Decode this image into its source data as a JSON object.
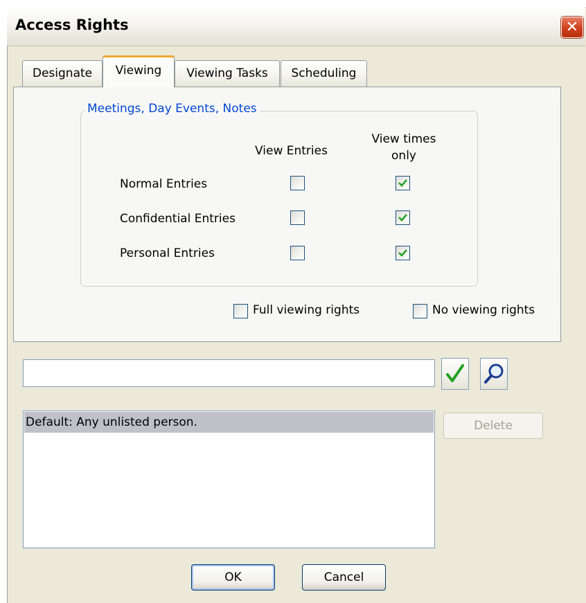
{
  "window": {
    "title": "Access Rights",
    "close_glyph": "✕"
  },
  "tabs": [
    {
      "label": "Designate",
      "active": false
    },
    {
      "label": "Viewing",
      "active": true
    },
    {
      "label": "Viewing Tasks",
      "active": false
    },
    {
      "label": "Scheduling",
      "active": false
    }
  ],
  "group": {
    "title": "Meetings, Day Events, Notes",
    "col_view_entries": "View Entries",
    "col_view_times_line1": "View times",
    "col_view_times_line2": "only",
    "rows": [
      {
        "label": "Normal Entries",
        "view_entries": false,
        "view_times_only": true
      },
      {
        "label": "Confidential Entries",
        "view_entries": false,
        "view_times_only": true
      },
      {
        "label": "Personal Entries",
        "view_entries": false,
        "view_times_only": true
      }
    ]
  },
  "options": {
    "full_viewing_rights": {
      "label": "Full viewing rights",
      "checked": false
    },
    "no_viewing_rights": {
      "label": "No viewing rights",
      "checked": false
    }
  },
  "name_input": {
    "value": ""
  },
  "icons": {
    "confirm": "check-icon",
    "search": "magnifier-icon"
  },
  "list": {
    "items": [
      "Default: Any unlisted person."
    ]
  },
  "buttons": {
    "delete": "Delete",
    "ok": "OK",
    "cancel": "Cancel"
  },
  "colors": {
    "accent_tab": "#f2a531",
    "group_title": "#0046d5",
    "check": "#21a121",
    "close": "#cf3f1c"
  }
}
